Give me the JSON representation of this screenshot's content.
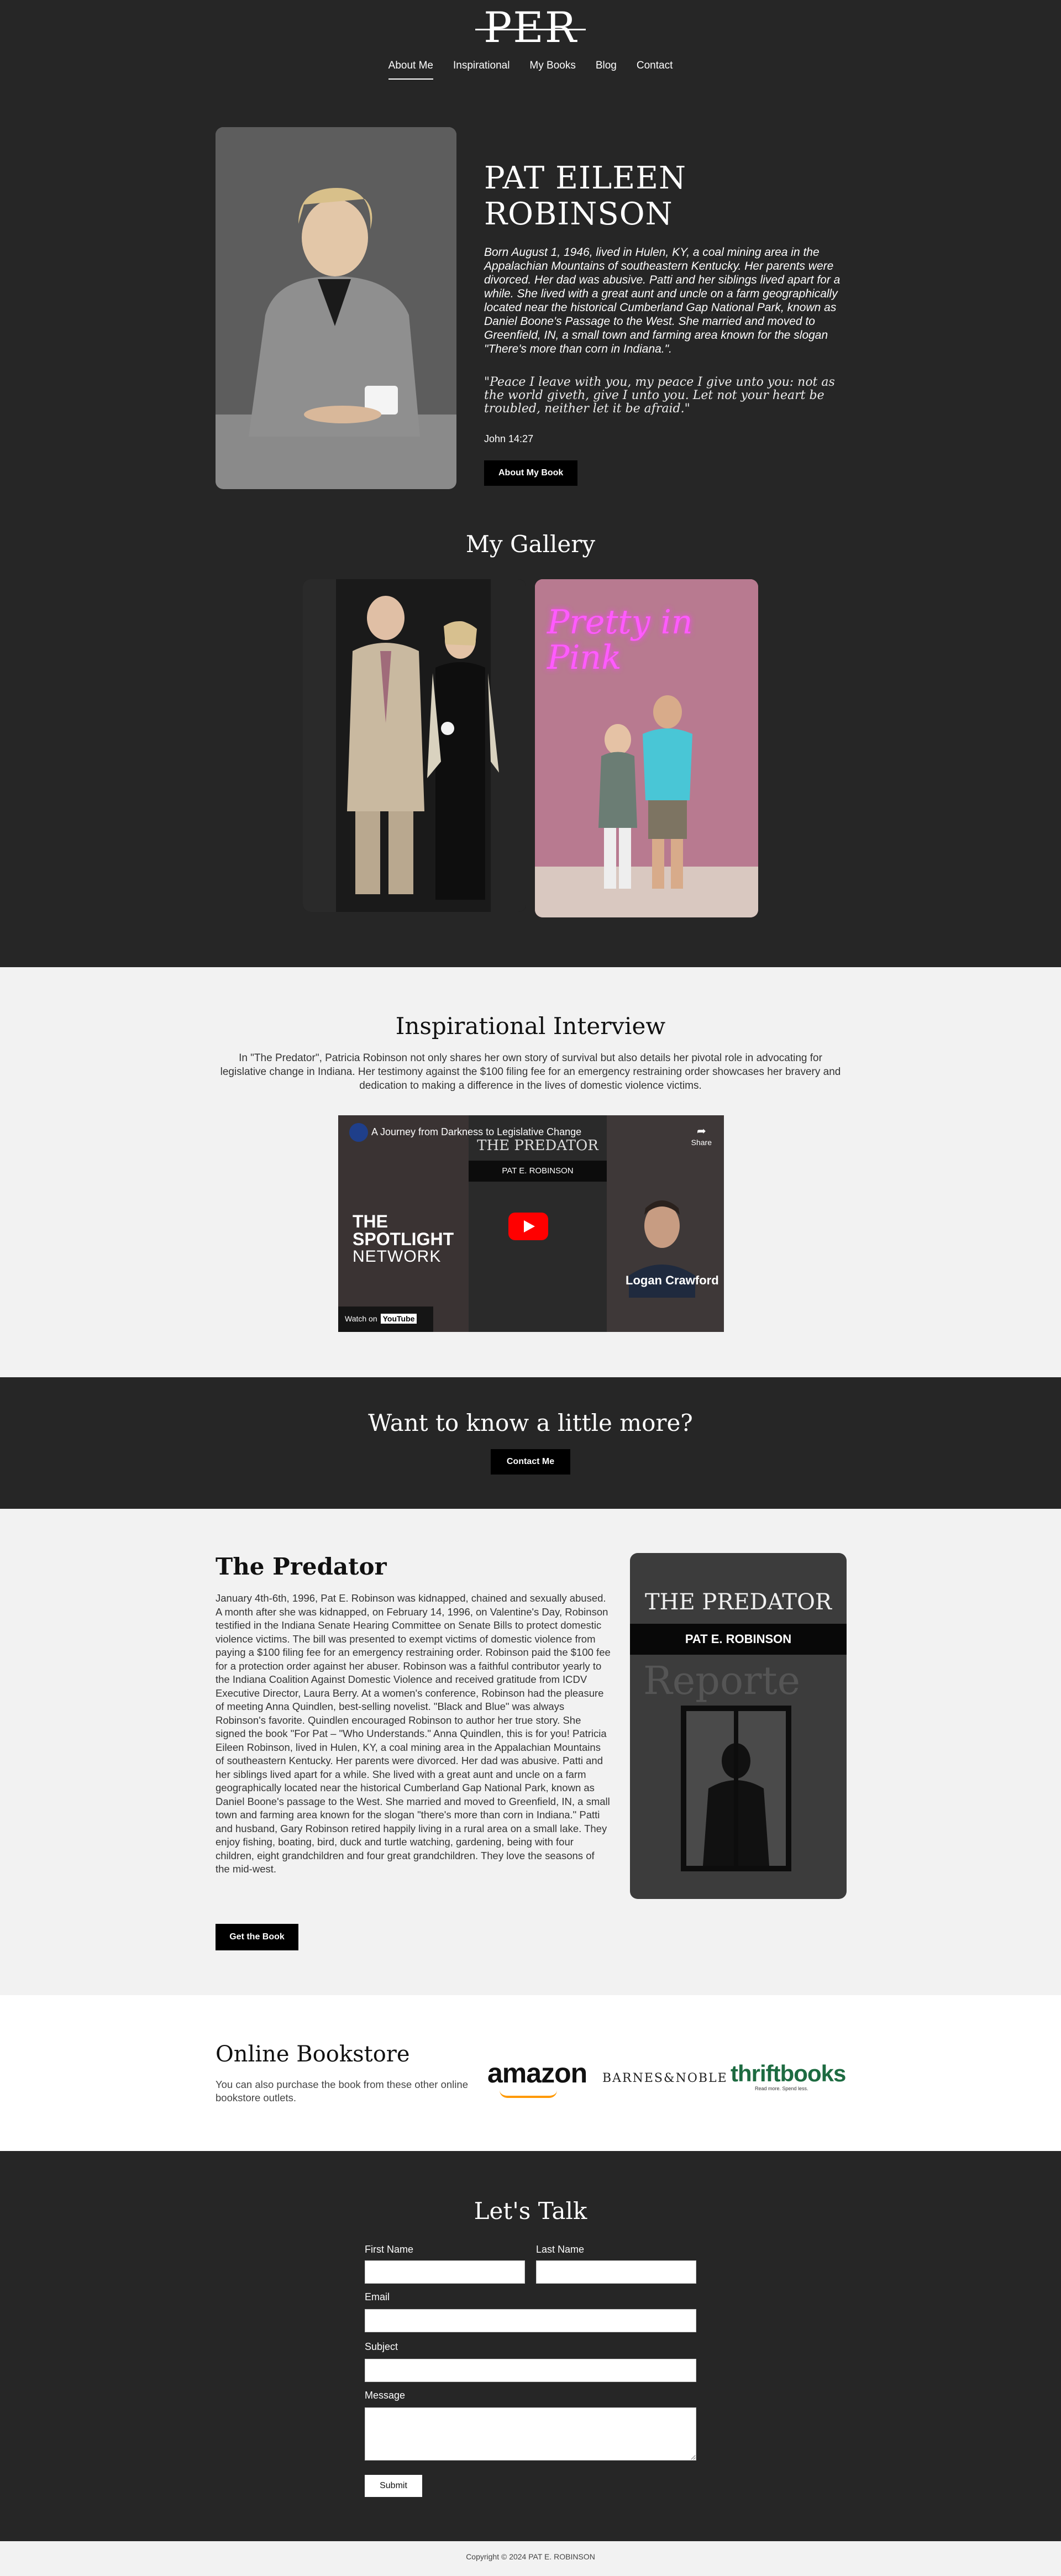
{
  "header": {
    "logo_text": "PER",
    "nav": [
      {
        "label": "About Me",
        "active": true
      },
      {
        "label": "Inspirational",
        "active": false
      },
      {
        "label": "My Books",
        "active": false
      },
      {
        "label": "Blog",
        "active": false
      },
      {
        "label": "Contact",
        "active": false
      }
    ]
  },
  "hero": {
    "title": "PAT EILEEN ROBINSON",
    "bio": "Born August 1, 1946, lived in Hulen, KY, a coal mining area in the Appalachian Mountains of southeastern Kentucky. Her parents were divorced. Her dad was abusive. Patti and her siblings lived apart for a while. She lived with a great aunt and uncle on a farm geographically located near the historical Cumberland Gap National Park, known as Daniel Boone's Passage to the West. She married and moved to Greenfield, IN, a small town and farming area known for the slogan \"There's more than corn in Indiana.\".",
    "quote": "\"Peace I leave with you, my peace I give unto you: not as the world giveth, give I unto you. Let not your heart be troubled, neither let it be afraid.\"",
    "quote_ref": "John 14:27",
    "button": "About My Book"
  },
  "gallery": {
    "title": "My Gallery",
    "neon_sign": "Pretty in Pink"
  },
  "interview": {
    "title": "Inspirational Interview",
    "text": "In \"The Predator\", Patricia Robinson not only shares her own story of survival but also details her pivotal role in advocating for legislative change in Indiana. Her testimony against the $100 filing fee for an emergency restraining order showcases her bravery and dedication to making a difference in the lives of domestic violence victims.",
    "video": {
      "title": "A Journey from Darkness to Legislative Change",
      "share": "Share",
      "watch_on": "Watch on",
      "youtube": "YouTube",
      "spot_line1": "THE",
      "spot_line2": "SPOTLIGHT",
      "spot_line3": "NETWORK",
      "book_title": "THE PREDATOR",
      "book_author": "PAT E. ROBINSON",
      "guest_name": "Logan Crawford"
    }
  },
  "more": {
    "title": "Want to know a little more?",
    "button": "Contact Me"
  },
  "predator": {
    "title": "The Predator",
    "text": "January 4th-6th, 1996, Pat E. Robinson was kidnapped, chained and sexually abused. A month after she was kidnapped, on February 14, 1996, on Valentine's Day, Robinson testified in the Indiana Senate Hearing Committee on Senate Bills to protect domestic violence victims. The bill was presented to exempt victims of domestic violence from paying a $100 filing fee for an emergency restraining order. Robinson paid the $100 fee for a protection order against her abuser. Robinson was a faithful contributor yearly to the Indiana Coalition Against Domestic Violence and received gratitude from ICDV Executive Director, Laura Berry. At a women's conference, Robinson had the pleasure of meeting Anna Quindlen, best-selling novelist. \"Black and Blue\" was always Robinson's favorite. Quindlen encouraged Robinson to author her true story. She signed the book \"For Pat – \"Who Understands.\" Anna Quindlen, this is for you! Patricia Eileen Robinson, lived in Hulen, KY, a coal mining area in the Appalachian Mountains of southeastern Kentucky. Her parents were divorced. Her dad was abusive. Patti and her siblings lived apart for a while. She lived with a great aunt and uncle on a farm geographically located near the historical Cumberland Gap National Park, known as Daniel Boone's passage to the West. She married and moved to Greenfield, IN, a small town and farming area known for the slogan \"there's more than corn in Indiana.\" Patti and husband, Gary Robinson retired happily living in a rural area on a small lake. They enjoy fishing, boating, bird, duck and turtle watching, gardening, being with four children, eight grandchildren and four great grandchildren. They love the seasons of the mid-west.",
    "button": "Get the Book",
    "cover_title": "THE PREDATOR",
    "cover_author": "PAT E. ROBINSON",
    "cover_paper": "Reporte"
  },
  "bookstore": {
    "title": "Online Bookstore",
    "text": "You can also purchase the book from these other online bookstore outlets.",
    "stores": [
      "amazon",
      "BARNES&NOBLE",
      "thriftbooks"
    ],
    "thriftbooks_tagline": "Read more. Spend less."
  },
  "contact": {
    "title": "Let's Talk",
    "first_name_label": "First Name",
    "last_name_label": "Last Name",
    "email_label": "Email",
    "subject_label": "Subject",
    "message_label": "Message",
    "submit": "Submit"
  },
  "footer": {
    "copyright": "Copyright © 2024 PAT E. ROBINSON"
  }
}
